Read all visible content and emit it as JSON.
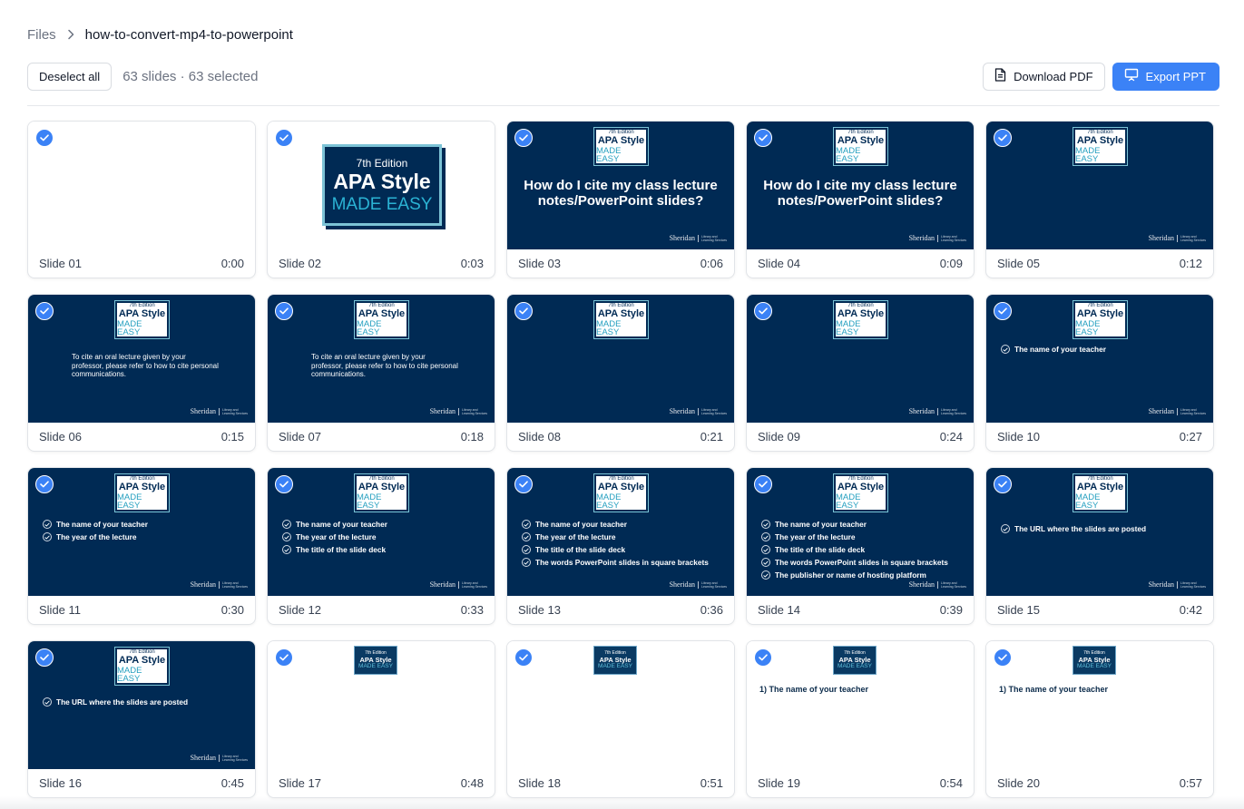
{
  "breadcrumb": {
    "root": "Files",
    "current": "how-to-convert-mp4-to-powerpoint"
  },
  "toolbar": {
    "deselect_label": "Deselect all",
    "count_text": "63 slides · 63 selected",
    "download_pdf_label": "Download PDF",
    "export_ppt_label": "Export PPT"
  },
  "colors": {
    "accent": "#3b82f6",
    "slide_bg": "#002a54",
    "logo_accent": "#26a0c0"
  },
  "logo": {
    "edition": "7th Edition",
    "title": "APA Style",
    "subtitle": "MADE EASY"
  },
  "sheridan": {
    "wordmark": "Sheridan",
    "sub": "Library and Learning Services"
  },
  "slides": [
    {
      "label": "Slide 01",
      "time": "0:00",
      "theme": "light"
    },
    {
      "label": "Slide 02",
      "time": "0:03",
      "theme": "light",
      "big_logo": true
    },
    {
      "label": "Slide 03",
      "time": "0:06",
      "theme": "dark",
      "heading": "How do I cite my class lecture notes/PowerPoint slides?"
    },
    {
      "label": "Slide 04",
      "time": "0:09",
      "theme": "dark",
      "heading": "How do I cite my class lecture notes/PowerPoint slides?"
    },
    {
      "label": "Slide 05",
      "time": "0:12",
      "theme": "dark"
    },
    {
      "label": "Slide 06",
      "time": "0:15",
      "theme": "dark",
      "paragraph": "To cite an oral lecture given by your professor, please refer to how to cite personal communications."
    },
    {
      "label": "Slide 07",
      "time": "0:18",
      "theme": "dark",
      "paragraph": "To cite an oral lecture given by your professor, please refer to how to cite personal communications."
    },
    {
      "label": "Slide 08",
      "time": "0:21",
      "theme": "dark"
    },
    {
      "label": "Slide 09",
      "time": "0:24",
      "theme": "dark"
    },
    {
      "label": "Slide 10",
      "time": "0:27",
      "theme": "dark",
      "checklist": [
        "The name of your teacher"
      ]
    },
    {
      "label": "Slide 11",
      "time": "0:30",
      "theme": "dark",
      "checklist": [
        "The name of your teacher",
        "The year of the lecture"
      ]
    },
    {
      "label": "Slide 12",
      "time": "0:33",
      "theme": "dark",
      "checklist": [
        "The name of your teacher",
        "The year of the lecture",
        "The title of the slide deck"
      ]
    },
    {
      "label": "Slide 13",
      "time": "0:36",
      "theme": "dark",
      "checklist": [
        "The name of your teacher",
        "The year of the lecture",
        "The title of the slide deck",
        "The words PowerPoint slides in square brackets"
      ]
    },
    {
      "label": "Slide 14",
      "time": "0:39",
      "theme": "dark",
      "checklist": [
        "The name of your teacher",
        "The year of the lecture",
        "The title of the slide deck",
        "The words PowerPoint slides in square brackets",
        "The publisher or name of hosting platform"
      ]
    },
    {
      "label": "Slide 15",
      "time": "0:42",
      "theme": "dark",
      "checklist": [
        "The URL where the slides are posted"
      ]
    },
    {
      "label": "Slide 16",
      "time": "0:45",
      "theme": "dark",
      "checklist": [
        "The URL where the slides are posted"
      ]
    },
    {
      "label": "Slide 17",
      "time": "0:48",
      "theme": "light",
      "small_logo": true
    },
    {
      "label": "Slide 18",
      "time": "0:51",
      "theme": "light",
      "small_logo": true
    },
    {
      "label": "Slide 19",
      "time": "0:54",
      "theme": "light",
      "small_logo": true,
      "line": "1) The name of your teacher"
    },
    {
      "label": "Slide 20",
      "time": "0:57",
      "theme": "light",
      "small_logo": true,
      "line": "1) The name of your teacher"
    }
  ]
}
